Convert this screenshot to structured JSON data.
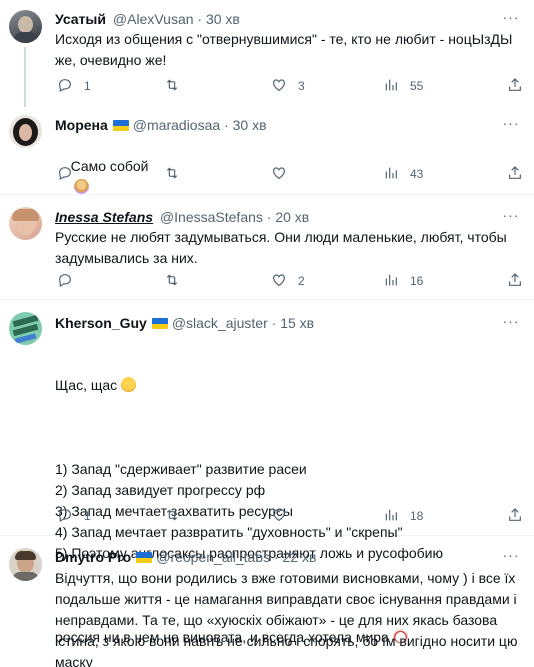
{
  "tweets": [
    {
      "name": "Усатый",
      "handle": "@AlexVusan",
      "time": "30 хв",
      "text": "Исходя из общения с \"отвернувшимися\" - те, кто не любит - ноцЫзДЫ же, очевидно же!",
      "replies": "1",
      "retweets": "",
      "likes": "3",
      "views": "55",
      "flag": false
    },
    {
      "name": "Морена",
      "handle": "@maradiosaa",
      "time": "30 хв",
      "text": "Само собой",
      "emoji": "woman-gesturing-icon",
      "replies": "",
      "retweets": "",
      "likes": "",
      "views": "43",
      "flag": true
    },
    {
      "name": "Inessa Stefans",
      "handle": "@InessaStefans",
      "time": "20 хв",
      "text": "Русские не любят задумываться. Они люди маленькие, любят, чтобы задумывались за них.",
      "replies": "",
      "retweets": "",
      "likes": "2",
      "views": "16",
      "flag": false
    },
    {
      "name": "Kherson_Guy",
      "handle": "@slack_ajuster",
      "time": "15 хв",
      "text": "Щас, щас",
      "emoji": "laughing-face-icon",
      "list": "1) Запад \"сдерживает\" развитие расеи\n2) Запад завидует прогрессу рф\n3) Запад мечтает захватить ресурсы\n4) Запад мечтает развратить \"духовность\" и \"скрепы\"\n5) Поэтому англосаксы распространяют ложь и русофобию",
      "closing": "россия ни в чем не виновата, и всегда хотела мира",
      "closing_emoji": "clown-face-icon",
      "replies": "1",
      "retweets": "",
      "likes": "",
      "views": "18",
      "flag": true
    },
    {
      "name": "Dmytro Pro",
      "handle": "@reopen_all_tabs",
      "time": "22 хв",
      "text": "Відчуття, що вони родились з вже готовими висновками, чому ) і все їх подальше життя - це намагання виправдати своє існування правдами і неправдами. Та те, що «хуюскіх обіжают» - це для них якась базова істина, з якою вони навіть не сильно і спорять, бо їм вигідно носити цю маску",
      "flag": true
    }
  ],
  "colors": {
    "muted": "#536471",
    "text": "#0f1419",
    "divider": "#eff3f4",
    "flag_blue": "#1d6fd6",
    "flag_yellow": "#f5cd16"
  }
}
